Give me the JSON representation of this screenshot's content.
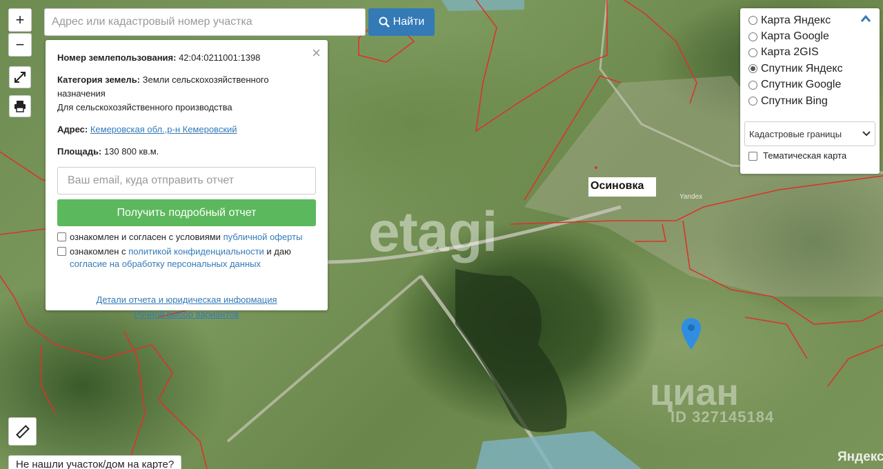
{
  "map": {
    "town_name": "Осиновка",
    "tile_label": "Yandex",
    "watermark_etagi": "etagi",
    "watermark_cian": "циан",
    "watermark_id": "ID 327145184",
    "provider_logo": "Яндекс"
  },
  "controls": {
    "zoom_in": "+",
    "zoom_out": "−",
    "not_found": "Не нашли участок/дом на карте?"
  },
  "search": {
    "placeholder": "Адрес или кадастровый номер участка",
    "button_label": "Найти"
  },
  "info": {
    "land_use_label": "Номер землепользования:",
    "land_use_value": "42:04:0211001:1398",
    "category_label": "Категория земель:",
    "category_value": "Земли сельскохозяйственного назначения",
    "category_purpose": "Для сельскохозяйственного производства",
    "address_label": "Адрес:",
    "address_value": "Кемеровская обл.,р-н Кемеровский",
    "area_label": "Площадь:",
    "area_value": "130 800 кв.м.",
    "email_placeholder": "Ваш email, куда отправить отчет",
    "report_button": "Получить подробный отчет",
    "consent1_text": "ознакомлен и согласен с условиями ",
    "consent1_link": "публичной оферты",
    "consent2_text": "ознакомлен с ",
    "consent2_link": "политикой конфиденциальности",
    "consent2_and": " и даю",
    "consent2_link2": "согласие на обработку персональных данных",
    "details_link": "Детали отчета и юридическая информация",
    "manual_link": "Ручной выбор вариантов",
    "close_icon": "×"
  },
  "layers": {
    "options": [
      {
        "label": "Карта Яндекс",
        "selected": false
      },
      {
        "label": "Карта Google",
        "selected": false
      },
      {
        "label": "Карта 2GIS",
        "selected": false
      },
      {
        "label": "Спутник Яндекс",
        "selected": true
      },
      {
        "label": "Спутник Google",
        "selected": false
      },
      {
        "label": "Спутник Bing",
        "selected": false
      }
    ],
    "select_value": "Кадастровые границы",
    "thematic_label": "Тематическая карта"
  },
  "colors": {
    "boundary": "#d9342b",
    "accent": "#337ab7",
    "report_button": "#5cb85c",
    "pin": "#2f8ee0"
  }
}
